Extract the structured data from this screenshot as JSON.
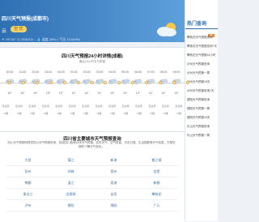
{
  "header": {
    "city": "四川天气预报(成都市)",
    "condition": "云",
    "pill": "空 优",
    "stats": "☀ 19°/10°   ◷ 2026/12/...   💧 湿度 26%   ◐ 气压 1014hPa",
    "icon": "partly-cloudy-icon"
  },
  "sidebar": {
    "title": "热门查询",
    "tag": "热",
    "links": [
      "攀枝花天气预报查询",
      "攀枝花天气预报查询7天",
      "攀枝花天气预报24小时",
      "泸州天气预报查询",
      "泸州天气预报一周",
      "泸州天气预报15天",
      "泸州天气预报查询7天",
      "德阳天气预报查询",
      "德阳天气预报一周",
      "德阳天气预报15天",
      "乐山天气预报查询",
      "乐山天气预报一周"
    ]
  },
  "hourly": {
    "title": "四川天气预报24小时详情(成都)",
    "subtitle": "最近24小时天气预报",
    "times": [
      "20:00",
      "21:00",
      "22:00",
      "23:00",
      "00:00",
      "01:00",
      "02:00",
      "03:00",
      "04:00",
      "05:00",
      "06:00",
      "07:00",
      "08:00",
      "09:00"
    ],
    "icons": [
      "cloud",
      "cloud",
      "cloud",
      "cloud",
      "cloud",
      "cloud",
      "cloud",
      "cloud",
      "cloud",
      "cloud",
      "cloud",
      "cloud",
      "cloud",
      "cloud"
    ],
    "temps": [
      "15°",
      "15°",
      "15°",
      "15°",
      "14°",
      "14°",
      "14°",
      "14°",
      "14°",
      "14°",
      "14°",
      "14°",
      "14°",
      "14°"
    ],
    "wind": [
      "东北风",
      "东北风",
      "东北风",
      "东北风",
      "东北风",
      "东北风",
      "东北风",
      "东北风",
      "东北风",
      "东北风",
      "东北风",
      "东北风",
      "东北风",
      "东北风"
    ],
    "level": [
      "<3级",
      "<3级",
      "<3级",
      "<3级",
      "<3级",
      "<3级",
      "<3级",
      "<3级",
      "<3级",
      "<3级",
      "<3级",
      "<3级",
      "<3级",
      "<3级"
    ]
  },
  "region": {
    "title": "四川省主要城市天气预报查询",
    "desc": "四川天气预报网提供四川天气预报查询，包括四川各地15天天气预报，实时天气、空气质量、日出日落、生活指数等天气信息，方便您随时了解天气变化。",
    "cities": [
      "大邑",
      "蒲江",
      "新津",
      "都江堰",
      "彭州",
      "邛崃",
      "崇州",
      "金堂",
      "郫都",
      "温江",
      "双流",
      "新都",
      "青白江",
      "龙泉驿",
      "自贡",
      "攀枝花",
      "泸州",
      "德阳",
      "绵阳",
      "广元"
    ]
  },
  "colors": {
    "accent": "#2f6fb3",
    "hero_start": "#2f6fb3",
    "hero_end": "#5ea0dc"
  }
}
